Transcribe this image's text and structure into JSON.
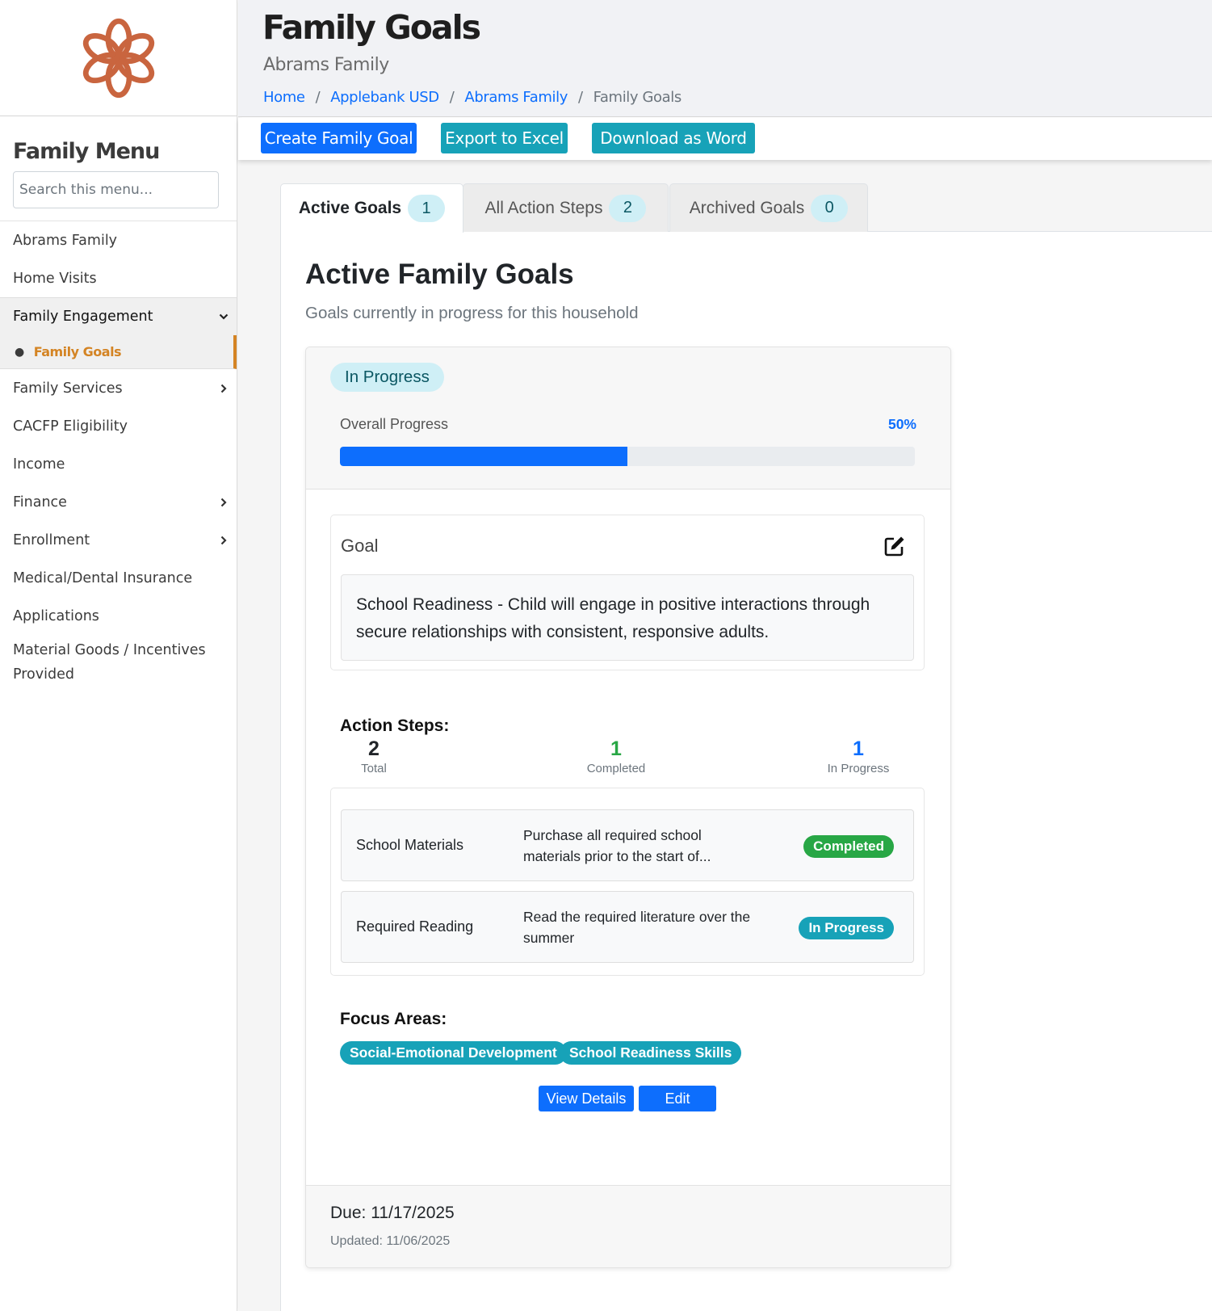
{
  "sidebar": {
    "logo_icon": "flower-logo-icon",
    "title": "Family Menu",
    "search_placeholder": "Search this menu...",
    "items": [
      {
        "label": "Abrams Family"
      },
      {
        "label": "Home Visits"
      },
      {
        "label": "Family Engagement",
        "expanded": true
      },
      {
        "label": "Family Goals",
        "active": true
      },
      {
        "label": "Family Services"
      },
      {
        "label": "CACFP Eligibility"
      },
      {
        "label": "Income"
      },
      {
        "label": "Finance"
      },
      {
        "label": "Enrollment"
      },
      {
        "label": "Medical/Dental Insurance"
      },
      {
        "label": "Applications"
      },
      {
        "label": "Material Goods / Incentives Provided"
      }
    ]
  },
  "header": {
    "title": "Family Goals",
    "subtitle": "Abrams Family",
    "breadcrumb": [
      {
        "label": "Home"
      },
      {
        "label": "Applebank USD"
      },
      {
        "label": "Abrams Family"
      },
      {
        "label": "Family Goals"
      }
    ],
    "separator": "/"
  },
  "toolbar": {
    "create_label": "Create Family Goal",
    "export_label": "Export to Excel",
    "download_label": "Download as Word"
  },
  "tabs": [
    {
      "label": "Active Goals",
      "count": "1",
      "active": true
    },
    {
      "label": "All Action Steps",
      "count": "2"
    },
    {
      "label": "Archived Goals",
      "count": "0"
    }
  ],
  "section": {
    "title": "Active Family Goals",
    "subtitle": "Goals currently in progress for this household"
  },
  "goal_card": {
    "status": "In Progress",
    "progress_label": "Overall Progress",
    "progress_text": "50%",
    "progress_value": 50,
    "goal_label": "Goal",
    "goal_text": "School Readiness - Child will engage in positive interactions through secure relationships with consistent, responsive adults.",
    "action_steps_heading": "Action Steps:",
    "stats": [
      {
        "value": "2",
        "label": "Total",
        "color": "#212529"
      },
      {
        "value": "1",
        "label": "Completed",
        "color": "#28a745"
      },
      {
        "value": "1",
        "label": "In Progress",
        "color": "#0d6efd"
      }
    ],
    "steps": [
      {
        "name": "School Materials",
        "description": "Purchase all required school materials prior to the start of...",
        "status": "Completed",
        "status_color": "#28a745"
      },
      {
        "name": "Required Reading",
        "description": "Read the required literature over the summer",
        "status": "In Progress",
        "status_color": "#17a2b8"
      }
    ],
    "focus_heading": "Focus Areas:",
    "focus_areas": [
      "Social-Emotional Development",
      "School Readiness Skills"
    ],
    "view_details_label": "View Details",
    "edit_label": "Edit",
    "due": "Due: 11/17/2025",
    "updated": "Updated: 11/06/2025"
  },
  "colors": {
    "primary": "#0d6efd",
    "info": "#17a2b8",
    "success": "#28a745",
    "accent": "#d48424",
    "logo": "#c9653f"
  }
}
